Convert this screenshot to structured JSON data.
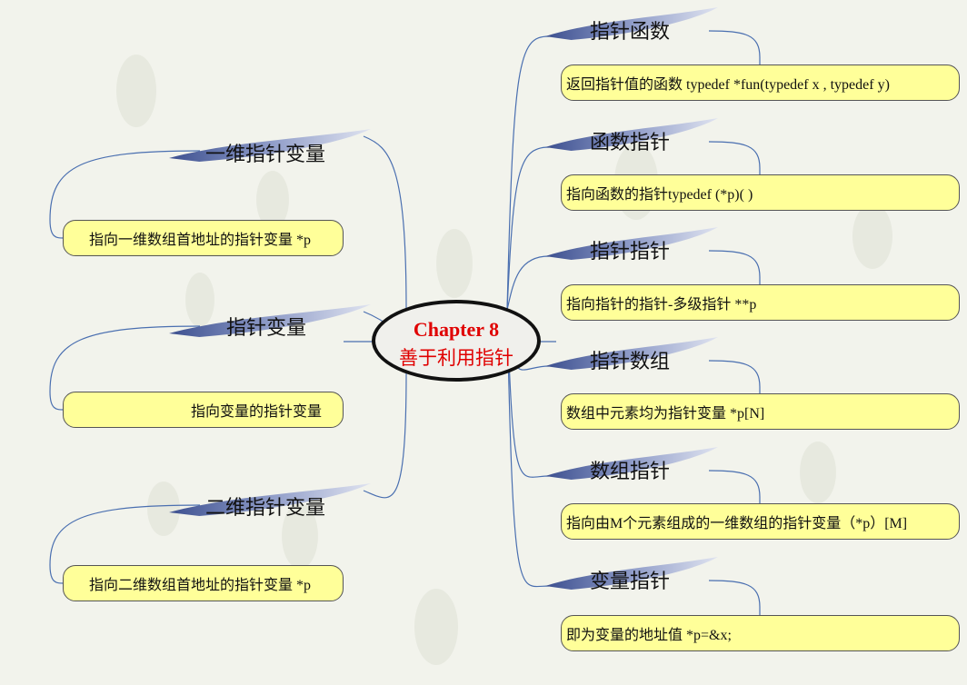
{
  "colors": {
    "background": "#f2f3ec",
    "box_fill": "#ffff99",
    "center_text": "#e00000",
    "connector": "#4a6fb0",
    "swoosh": "#5b6ea8"
  },
  "center": {
    "line1": "Chapter 8",
    "line2": "善于利用指针"
  },
  "left_branches": [
    {
      "title": "一维指针变量",
      "detail": "指向一维数组首地址的指针变量 *p"
    },
    {
      "title": "指针变量",
      "detail": "指向变量的指针变量"
    },
    {
      "title": "二维指针变量",
      "detail": "指向二维数组首地址的指针变量 *p"
    }
  ],
  "right_branches": [
    {
      "title": "指针函数",
      "detail": "返回指针值的函数 typedef  *fun(typedef x , typedef y)"
    },
    {
      "title": "函数指针",
      "detail": "指向函数的指针typedef (*p)(    )"
    },
    {
      "title": "指针指针",
      "detail": "指向指针的指针-多级指针 **p"
    },
    {
      "title": "指针数组",
      "detail": "数组中元素均为指针变量 *p[N]"
    },
    {
      "title": "数组指针",
      "detail": "指向由M个元素组成的一维数组的指针变量（*p）[M]"
    },
    {
      "title": "变量指针",
      "detail": "即为变量的地址值 *p=&x;"
    }
  ]
}
